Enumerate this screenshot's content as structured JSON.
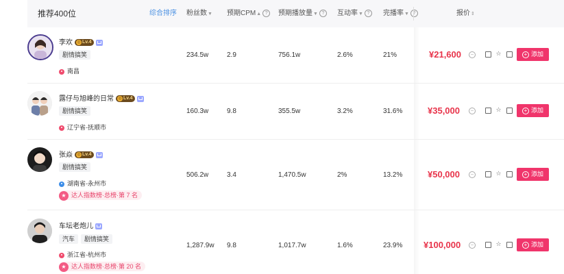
{
  "header": {
    "title": "推荐400位",
    "sort_link": "综合排序",
    "columns": {
      "fans": "粉丝数",
      "cpm": "预期CPM",
      "plays": "预期播放量",
      "interaction": "互动率",
      "completion": "完播率",
      "price": "报价"
    }
  },
  "rows": [
    {
      "name": "李欢",
      "level": "Lv.4",
      "tags": [
        "剧情搞笑"
      ],
      "location": "南昌",
      "location_icon": "red-pin-icon",
      "rank": "",
      "fans": "234.5w",
      "cpm": "2.9",
      "plays": "756.1w",
      "interaction": "2.6%",
      "completion": "21%",
      "price": "¥21,600",
      "add_label": "添加"
    },
    {
      "name": "露仔与旭峰的日常",
      "level": "Lv.4",
      "tags": [
        "剧情搞笑"
      ],
      "location": "辽宁省-抚顺市",
      "location_icon": "red-pin-icon",
      "rank": "",
      "fans": "160.3w",
      "cpm": "9.8",
      "plays": "355.5w",
      "interaction": "3.2%",
      "completion": "31.6%",
      "price": "¥35,000",
      "add_label": "添加"
    },
    {
      "name": "张焱",
      "level": "Lv.4",
      "tags": [
        "剧情搞笑"
      ],
      "location": "湖南省-永州市",
      "location_icon": "blue-pin-icon",
      "rank": "达人指数榜·总榜·第 7 名",
      "fans": "506.2w",
      "cpm": "3.4",
      "plays": "1,470.5w",
      "interaction": "2%",
      "completion": "13.2%",
      "price": "¥50,000",
      "add_label": "添加"
    },
    {
      "name": "车坛老炮儿",
      "level": "",
      "tags": [
        "汽车",
        "剧情搞笑"
      ],
      "location": "浙江省-杭州市",
      "location_icon": "red-pin-icon",
      "rank": "达人指数榜·总榜·第 20 名",
      "fans": "1,287.9w",
      "cpm": "9.8",
      "plays": "1,017.7w",
      "interaction": "1.6%",
      "completion": "23.9%",
      "price": "¥100,000",
      "add_label": "添加"
    }
  ],
  "colors": {
    "accent": "#f0356b",
    "price": "#e8334a",
    "link": "#4a90e2"
  }
}
